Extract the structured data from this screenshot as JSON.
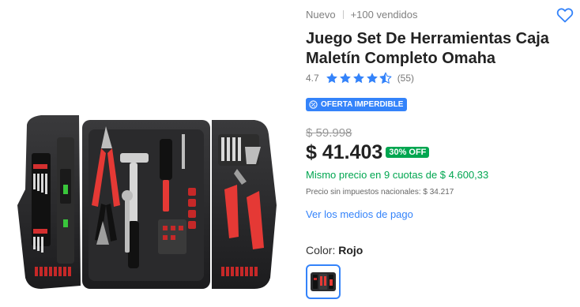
{
  "product": {
    "condition": "Nuevo",
    "sold": "+100 vendidos",
    "title": "Juego Set De Herramientas Caja Maletín Completo Omaha",
    "rating": {
      "score": "4.7",
      "stars": 4.7,
      "count": "(55)"
    },
    "badge": "OFERTA IMPERDIBLE",
    "original_price": "$ 59.998",
    "price": "$ 41.403",
    "discount": "30% OFF",
    "installments": "Mismo precio en 9 cuotas de $ 4.600,33",
    "tax_note": "Precio sin impuestos nacionales: $ 34.217",
    "payment_link": "Ver los medios de pago",
    "color": {
      "label": "Color:",
      "value": "Rojo"
    }
  },
  "icons": {
    "favorite": "heart-icon",
    "star_full": "star-icon",
    "star_half": "star-half-icon",
    "badge": "offer-tag-icon"
  },
  "colors": {
    "accent_blue": "#3483fa",
    "green": "#00a650",
    "text_dark": "#222222",
    "text_muted": "#999999"
  }
}
